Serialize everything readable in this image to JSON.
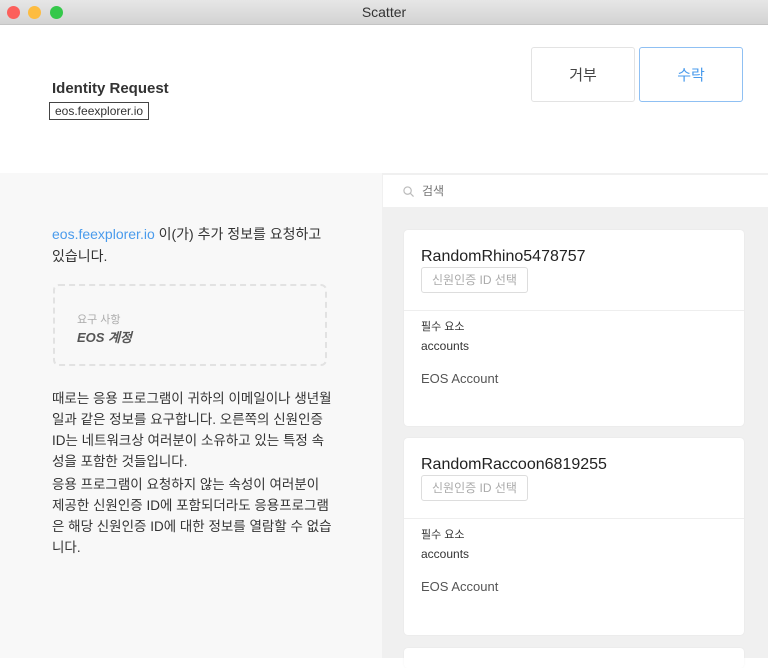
{
  "window": {
    "title": "Scatter"
  },
  "header": {
    "title": "Identity Request",
    "origin": "eos.feexplorer.io",
    "deny_label": "거부",
    "accept_label": "수락"
  },
  "left": {
    "origin_link": "eos.feexplorer.io",
    "intro_text": " 이(가) 추가 정보를 요청하고 있습니다.",
    "requirements_label": "요구 사항",
    "requirements_value": "EOS 계정",
    "desc1": "때로는 응용 프로그램이 귀하의 이메일이나 생년월일과 같은 정보를 요구합니다. 오른쪽의 신원인증 ID는 네트워크상 여러분이 소유하고 있는 특정 속성을 포함한 것들입니다.",
    "desc2": "응용 프로그램이 요청하지 않는 속성이 여러분이 제공한 신원인증 ID에 포함되더라도 응용프로그램은 해당 신원인증 ID에 대한 정보를 열람할 수 없습니다."
  },
  "search": {
    "placeholder": "검색"
  },
  "identities": [
    {
      "name": "RandomRhino5478757",
      "select_label": "신원인증 ID 선택",
      "required_label": "필수 요소",
      "required_value": "accounts",
      "account": "EOS Account"
    },
    {
      "name": "RandomRaccoon6819255",
      "select_label": "신원인증 ID 선택",
      "required_label": "필수 요소",
      "required_value": "accounts",
      "account": "EOS Account"
    }
  ],
  "colors": {
    "accent": "#4a9bec"
  }
}
